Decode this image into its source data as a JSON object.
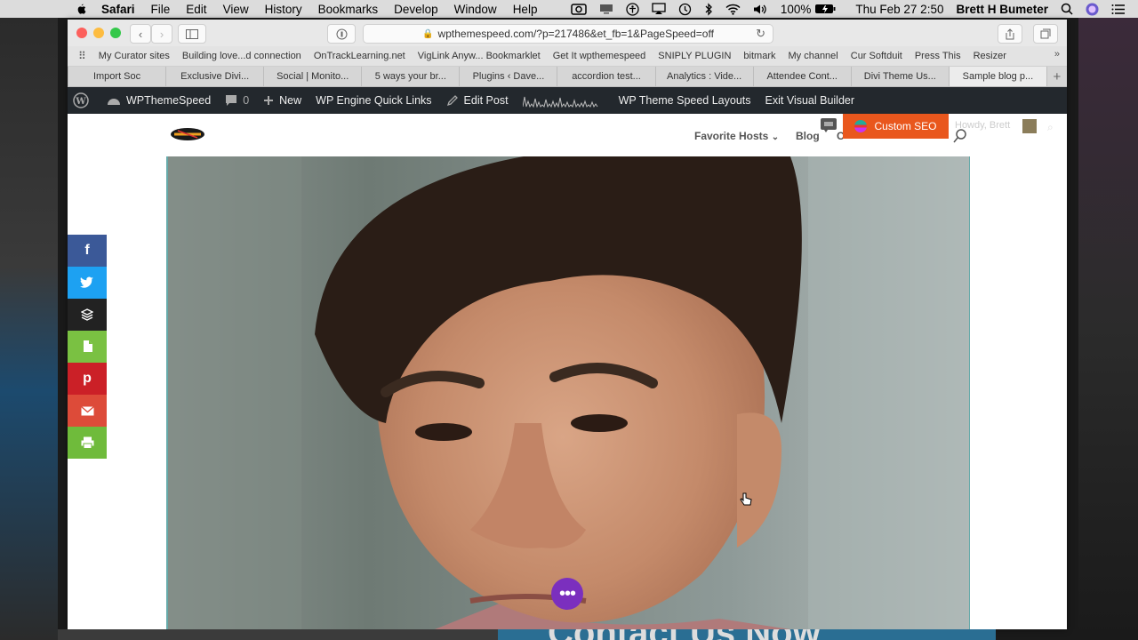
{
  "menubar": {
    "app": "Safari",
    "items": [
      "File",
      "Edit",
      "View",
      "History",
      "Bookmarks",
      "Develop",
      "Window",
      "Help"
    ],
    "battery": "100%",
    "datetime": "Thu Feb 27  2:50",
    "user": "Brett H Bumeter"
  },
  "browser": {
    "url": "wpthemespeed.com/?p=217486&et_fb=1&PageSpeed=off",
    "bookmarks": [
      "My Curator sites",
      "Building love...d connection",
      "OnTrackLearning.net",
      "VigLink Anyw... Bookmarklet",
      "Get It wpthemespeed",
      "SNIPLY PLUGIN",
      "bitmark",
      "My channel",
      "Cur Softduit",
      "Press This",
      "Resizer"
    ],
    "tabs": [
      "Import Soc",
      "Exclusive Divi...",
      "Social | Monito...",
      "5 ways your br...",
      "Plugins ‹ Dave...",
      "accordion test...",
      "Analytics : Vide...",
      "Attendee Cont...",
      "Divi Theme Us...",
      "Sample blog p..."
    ]
  },
  "adminbar": {
    "site": "WPThemeSpeed",
    "comments": "0",
    "new": "New",
    "wpengine": "WP Engine Quick Links",
    "edit_post": "Edit Post",
    "layouts": "WP Theme Speed Layouts",
    "exit": "Exit Visual Builder"
  },
  "header": {
    "nav_hosts": "Favorite Hosts",
    "nav_blog": "Blog",
    "nav_c": "C",
    "seo": "Custom SEO",
    "howdy": "Howdy, Brett"
  },
  "social": [
    {
      "name": "facebook",
      "glyph": "f",
      "color": "#3b5998"
    },
    {
      "name": "twitter",
      "glyph": "t",
      "color": "#1da1f2"
    },
    {
      "name": "buffer",
      "glyph": "≡",
      "color": "#222222"
    },
    {
      "name": "evernote",
      "glyph": "e",
      "color": "#7ac142"
    },
    {
      "name": "pinterest",
      "glyph": "p",
      "color": "#cb2027"
    },
    {
      "name": "email",
      "glyph": "✉",
      "color": "#dd4b39"
    },
    {
      "name": "print",
      "glyph": "⎙",
      "color": "#6fbb3b"
    }
  ],
  "fab": "•••",
  "below_text": "Contact Us Now"
}
